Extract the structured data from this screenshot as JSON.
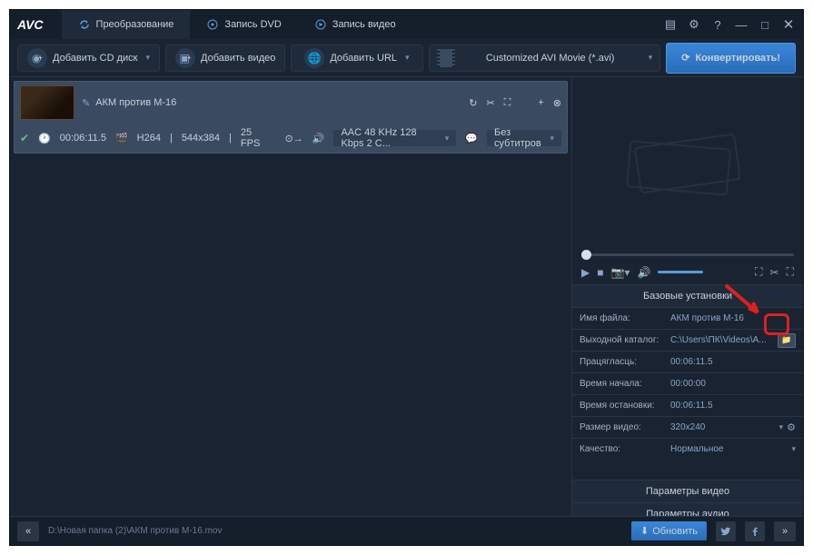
{
  "app": {
    "logo": "AVC"
  },
  "tabs": {
    "convert": "Преобразование",
    "dvd": "Запись DVD",
    "record": "Запись видео"
  },
  "toolbar": {
    "add_cd": "Добавить CD диск",
    "add_video": "Добавить видео",
    "add_url": "Добавить URL",
    "profile": "Customized AVI Movie (*.avi)",
    "convert": "Конвертировать!"
  },
  "item": {
    "title": "АКМ против М-16",
    "duration": "00:06:11.5",
    "codec": "H264",
    "resolution": "544x384",
    "fps": "25 FPS",
    "audio": "AAC 48 KHz 128 Kbps 2 C...",
    "subtitle": "Без субтитров"
  },
  "settings": {
    "title": "Базовые установки",
    "filename_label": "Имя файла:",
    "filename": "АКМ против М-16",
    "output_label": "Выходной каталог:",
    "output": "C:\\Users\\ПК\\Videos\\A...",
    "duration_label": "Працягласць:",
    "duration": "00:06:11.5",
    "start_label": "Время начала:",
    "start": "00:00:00",
    "stop_label": "Время остановки:",
    "stop": "00:06:11.5",
    "size_label": "Размер видео:",
    "size": "320x240",
    "quality_label": "Качество:",
    "quality": "Нормальное",
    "video_params": "Параметры видео",
    "audio_params": "Параметры аудио"
  },
  "status": {
    "path": "D:\\Новая папка (2)\\АКМ против М-16.mov",
    "update": "Обновить"
  }
}
